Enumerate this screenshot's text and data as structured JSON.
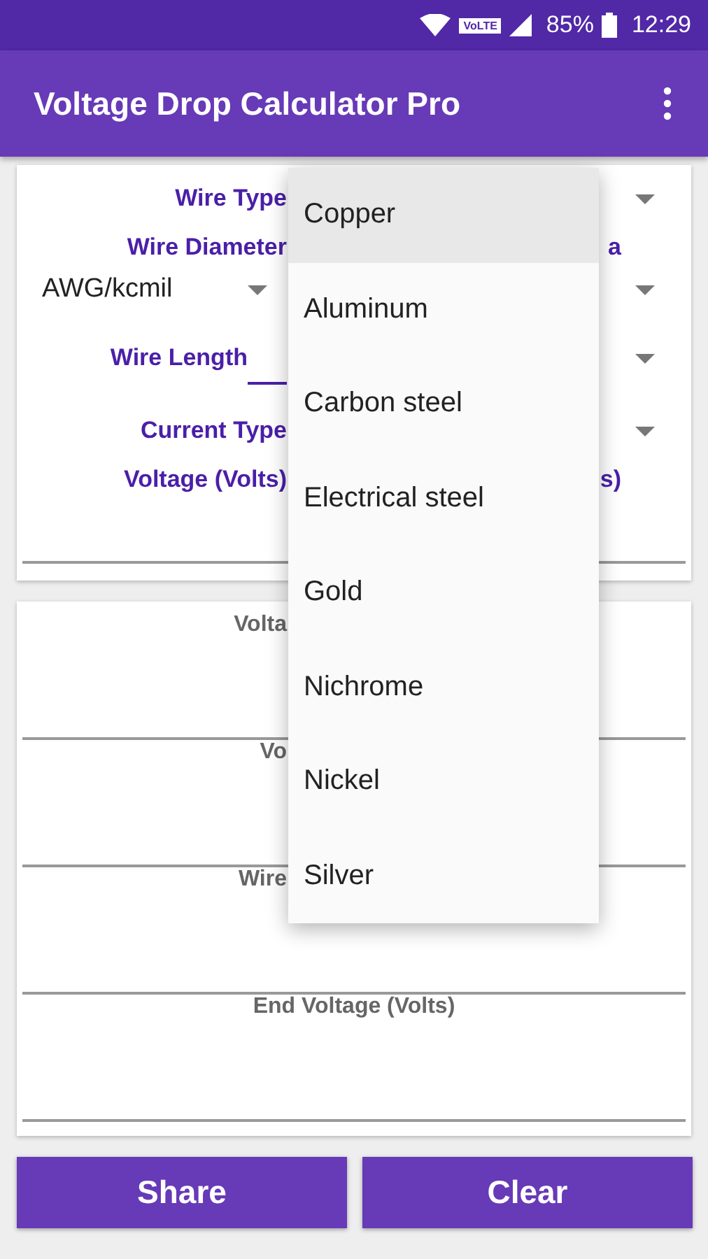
{
  "status_bar": {
    "network": "VoLTE",
    "battery": "85%",
    "time": "12:29"
  },
  "app_bar": {
    "title": "Voltage Drop Calculator Pro"
  },
  "inputs": [
    {
      "label": "Wire Type",
      "kind": "spinner"
    },
    {
      "label": "Wire Diameter",
      "label_right": "a",
      "kind": "heading"
    },
    {
      "value": "AWG/kcmil",
      "kind": "spinner_pair"
    },
    {
      "label": "Wire Length",
      "kind": "input"
    },
    {
      "label": "Current Type",
      "kind": "spinner"
    },
    {
      "label": "Voltage (Volts)",
      "label_right": "s)",
      "kind": "heading"
    }
  ],
  "results": [
    {
      "label": "Volta"
    },
    {
      "label": "Vo"
    },
    {
      "label": "Wire"
    },
    {
      "label": "End Voltage (Volts)"
    }
  ],
  "buttons": [
    "Share",
    "Clear"
  ],
  "dropdown": [
    {
      "label": "Copper",
      "selected": true
    },
    {
      "label": "Aluminum",
      "selected": false
    },
    {
      "label": "Carbon steel",
      "selected": false
    },
    {
      "label": "Electrical steel",
      "selected": false
    },
    {
      "label": "Gold",
      "selected": false
    },
    {
      "label": "Nichrome",
      "selected": false
    },
    {
      "label": "Nickel",
      "selected": false
    },
    {
      "label": "Silver",
      "selected": false
    }
  ]
}
